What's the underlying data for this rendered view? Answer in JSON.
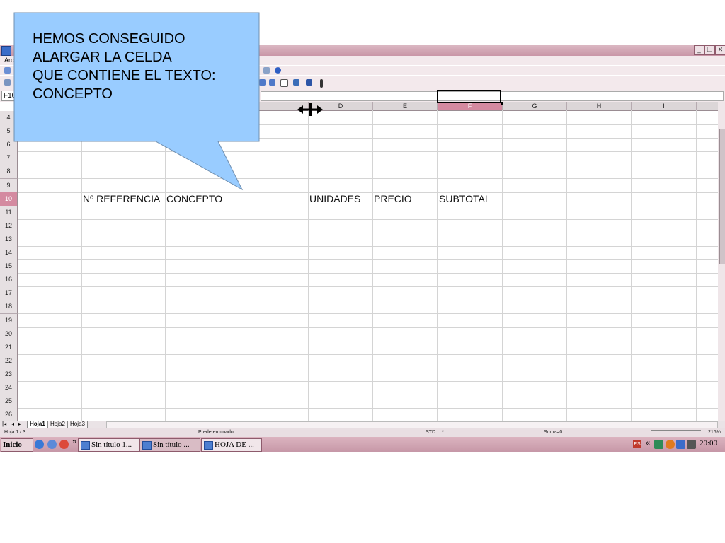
{
  "callout": {
    "lines": [
      "HEMOS CONSEGUIDO",
      "ALARGAR LA CELDA",
      "QUE CONTIENE EL TEXTO:",
      "CONCEPTO"
    ]
  },
  "window": {
    "menu_partial": "Arc",
    "controls": [
      "_",
      "❐",
      "✕"
    ]
  },
  "formula_bar": {
    "name_box": "F10"
  },
  "columns": [
    "D",
    "E",
    "F",
    "G",
    "H",
    "I"
  ],
  "selected_column": "F",
  "rows": [
    "4",
    "5",
    "6",
    "7",
    "8",
    "9",
    "10",
    "11",
    "12",
    "13",
    "14",
    "15",
    "16",
    "17",
    "18",
    "19",
    "20",
    "21",
    "22",
    "23",
    "24",
    "25",
    "26"
  ],
  "selected_row": "10",
  "cells": {
    "b10": "Nº REFERENCIA",
    "c10": "CONCEPTO",
    "d10": "UNIDADES",
    "e10": "PRECIO",
    "f10": "SUBTOTAL"
  },
  "sheet_tabs": [
    "Hoja1",
    "Hoja2",
    "Hoja3"
  ],
  "active_sheet": "Hoja1",
  "status": {
    "sheet": "Hoja 1 / 3",
    "style": "Predeterminado",
    "mode": "STD",
    "modified": "*",
    "sum": "Suma=0",
    "zoom": "216%"
  },
  "taskbar": {
    "start_label": "Inicio",
    "overflow": "»",
    "buttons": [
      "Sin título 1...",
      "Sin título ...",
      "HOJA DE ..."
    ],
    "lang": "ES",
    "tray_chevron": "«",
    "clock": "20:00"
  },
  "colors": {
    "chrome": "#c996a7",
    "selected_header": "#d48aa0",
    "callout_fill": "#99ccff"
  }
}
